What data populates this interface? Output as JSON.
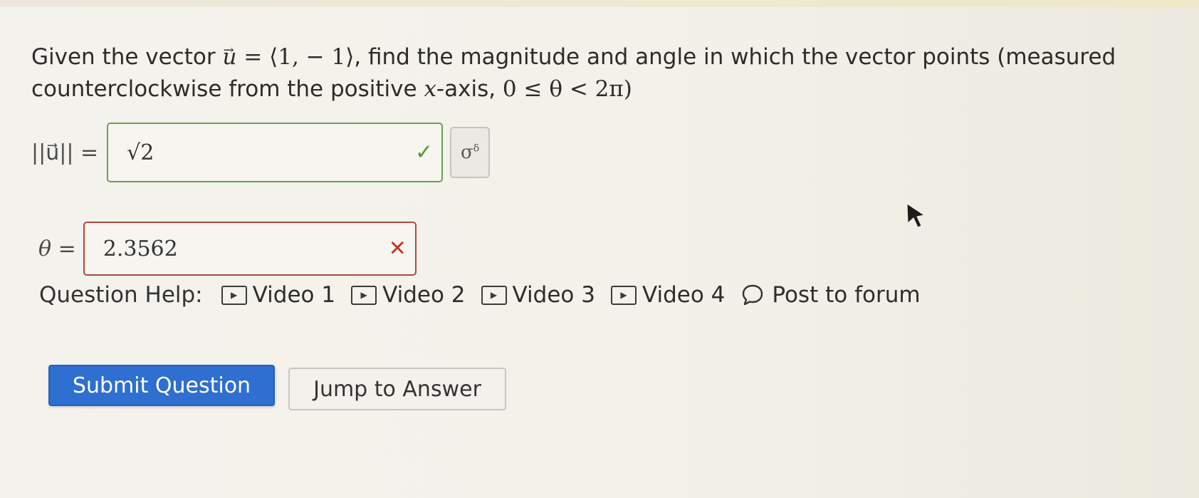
{
  "question": {
    "prefix": "Given the vector ",
    "vector_symbol": "u",
    "arrow": "→",
    "equals": " = ",
    "vector_value": "⟨1, − 1⟩",
    "mid_text": ", find the magnitude and angle in which the vector points (measured counterclockwise from the positive ",
    "x_var": "x",
    "axis_text": "-axis, ",
    "range": "0 ≤ θ < 2π)"
  },
  "magnitude": {
    "lhs": "||u⃗|| =",
    "value": "√2",
    "status": "correct",
    "status_icon": "check-icon",
    "preview_label": "σ",
    "preview_sup": "δ"
  },
  "angle": {
    "lhs": "θ =",
    "value": "2.3562",
    "status": "incorrect",
    "status_icon": "cross-icon"
  },
  "help": {
    "label": "Question Help:",
    "links": [
      {
        "label": "Video 1",
        "icon": "play-icon"
      },
      {
        "label": "Video 2",
        "icon": "play-icon"
      },
      {
        "label": "Video 3",
        "icon": "play-icon"
      },
      {
        "label": "Video 4",
        "icon": "play-icon"
      }
    ],
    "forum": {
      "label": "Post to forum",
      "icon": "chat-bubble-icon"
    }
  },
  "buttons": {
    "submit": "Submit Question",
    "jump": "Jump to Answer"
  },
  "colors": {
    "primary": "#2e6fd1",
    "correct": "#4c9a34",
    "incorrect": "#c4362b"
  }
}
